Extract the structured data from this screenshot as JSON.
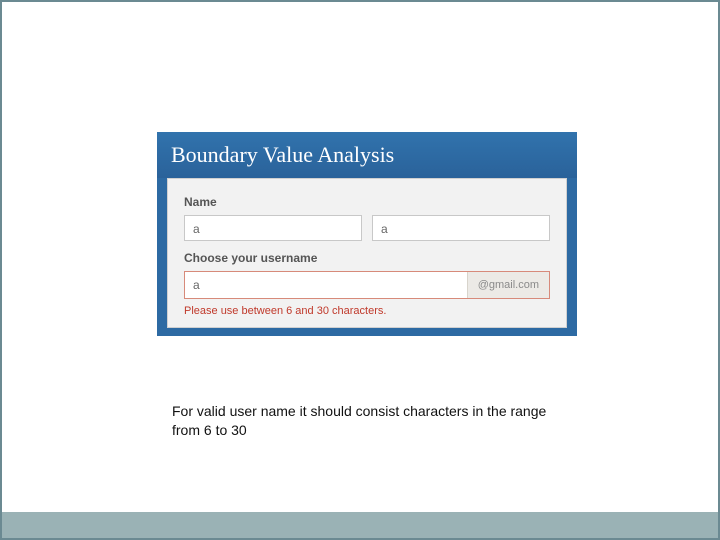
{
  "banner": {
    "title": "Boundary Value Analysis"
  },
  "form": {
    "name_label": "Name",
    "first_name_value": "a",
    "last_name_value": "a",
    "username_label": "Choose your username",
    "username_value": "a",
    "username_suffix": "@gmail.com",
    "error_message": "Please use between 6 and 30 characters."
  },
  "caption": "For valid user name it should consist characters in the range from 6 to 30"
}
